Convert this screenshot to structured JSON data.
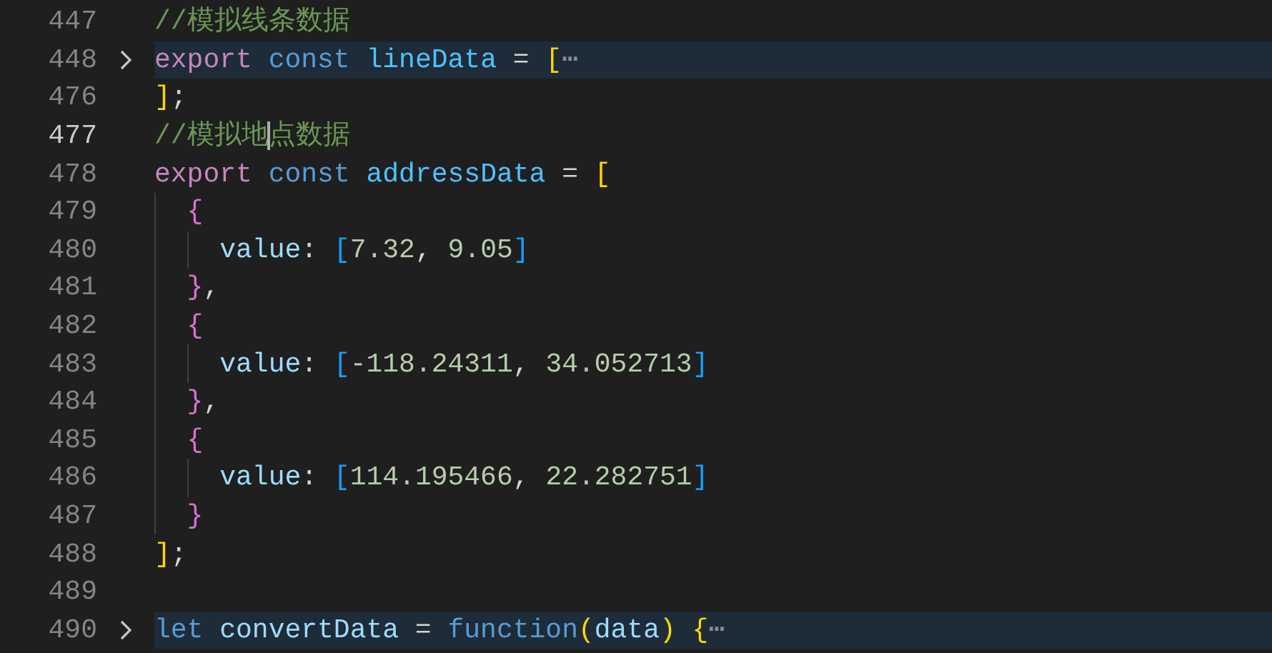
{
  "editor": {
    "lines": [
      {
        "number": "447",
        "folded": false,
        "current": false,
        "tokens": [
          {
            "kind": "comment",
            "text": "//模拟线条数据"
          }
        ]
      },
      {
        "number": "448",
        "folded": true,
        "current": false,
        "tokens": [
          {
            "kind": "keyword",
            "text": "export "
          },
          {
            "kind": "storage",
            "text": "const "
          },
          {
            "kind": "constant",
            "text": "lineData"
          },
          {
            "kind": "plain",
            "text": " = "
          },
          {
            "kind": "bracket1",
            "text": "["
          },
          {
            "kind": "ellipsis",
            "text": "⋯"
          }
        ]
      },
      {
        "number": "476",
        "folded": false,
        "current": false,
        "tokens": [
          {
            "kind": "bracket1",
            "text": "]"
          },
          {
            "kind": "plain",
            "text": ";"
          }
        ]
      },
      {
        "number": "477",
        "folded": false,
        "current": true,
        "tokens": [
          {
            "kind": "comment",
            "text": "//模拟地"
          },
          {
            "kind": "cursor"
          },
          {
            "kind": "comment",
            "text": "点数据"
          }
        ]
      },
      {
        "number": "478",
        "folded": false,
        "current": false,
        "tokens": [
          {
            "kind": "keyword",
            "text": "export "
          },
          {
            "kind": "storage",
            "text": "const "
          },
          {
            "kind": "constant",
            "text": "addressData"
          },
          {
            "kind": "plain",
            "text": " = "
          },
          {
            "kind": "bracket1",
            "text": "["
          }
        ]
      },
      {
        "number": "479",
        "folded": false,
        "current": false,
        "tokens": [
          {
            "kind": "bracket2",
            "text": "  {"
          }
        ]
      },
      {
        "number": "480",
        "folded": false,
        "current": false,
        "tokens": [
          {
            "kind": "property",
            "text": "    value"
          },
          {
            "kind": "plain",
            "text": ": "
          },
          {
            "kind": "bracket3",
            "text": "["
          },
          {
            "kind": "number",
            "text": "7.32"
          },
          {
            "kind": "plain",
            "text": ", "
          },
          {
            "kind": "number",
            "text": "9.05"
          },
          {
            "kind": "bracket3",
            "text": "]"
          }
        ]
      },
      {
        "number": "481",
        "folded": false,
        "current": false,
        "tokens": [
          {
            "kind": "bracket2",
            "text": "  }"
          },
          {
            "kind": "plain",
            "text": ","
          }
        ]
      },
      {
        "number": "482",
        "folded": false,
        "current": false,
        "tokens": [
          {
            "kind": "bracket2",
            "text": "  {"
          }
        ]
      },
      {
        "number": "483",
        "folded": false,
        "current": false,
        "tokens": [
          {
            "kind": "property",
            "text": "    value"
          },
          {
            "kind": "plain",
            "text": ": "
          },
          {
            "kind": "bracket3",
            "text": "["
          },
          {
            "kind": "number",
            "text": "-118.24311"
          },
          {
            "kind": "plain",
            "text": ", "
          },
          {
            "kind": "number",
            "text": "34.052713"
          },
          {
            "kind": "bracket3",
            "text": "]"
          }
        ]
      },
      {
        "number": "484",
        "folded": false,
        "current": false,
        "tokens": [
          {
            "kind": "bracket2",
            "text": "  }"
          },
          {
            "kind": "plain",
            "text": ","
          }
        ]
      },
      {
        "number": "485",
        "folded": false,
        "current": false,
        "tokens": [
          {
            "kind": "bracket2",
            "text": "  {"
          }
        ]
      },
      {
        "number": "486",
        "folded": false,
        "current": false,
        "tokens": [
          {
            "kind": "property",
            "text": "    value"
          },
          {
            "kind": "plain",
            "text": ": "
          },
          {
            "kind": "bracket3",
            "text": "["
          },
          {
            "kind": "number",
            "text": "114.195466"
          },
          {
            "kind": "plain",
            "text": ", "
          },
          {
            "kind": "number",
            "text": "22.282751"
          },
          {
            "kind": "bracket3",
            "text": "]"
          }
        ]
      },
      {
        "number": "487",
        "folded": false,
        "current": false,
        "tokens": [
          {
            "kind": "bracket2",
            "text": "  }"
          }
        ]
      },
      {
        "number": "488",
        "folded": false,
        "current": false,
        "tokens": [
          {
            "kind": "bracket1",
            "text": "]"
          },
          {
            "kind": "plain",
            "text": ";"
          }
        ]
      },
      {
        "number": "489",
        "folded": false,
        "current": false
      },
      {
        "number": "490",
        "folded": true,
        "current": false,
        "tokens": [
          {
            "kind": "storage",
            "text": "let "
          },
          {
            "kind": "variable",
            "text": "convertData"
          },
          {
            "kind": "plain",
            "text": " = "
          },
          {
            "kind": "storage",
            "text": "function"
          },
          {
            "kind": "bracket2y",
            "text": "("
          },
          {
            "kind": "variable",
            "text": "data"
          },
          {
            "kind": "bracket2y",
            "text": ")"
          },
          {
            "kind": "bracket1",
            "text": " {"
          },
          {
            "kind": "ellipsis",
            "text": "⋯"
          }
        ]
      }
    ]
  }
}
